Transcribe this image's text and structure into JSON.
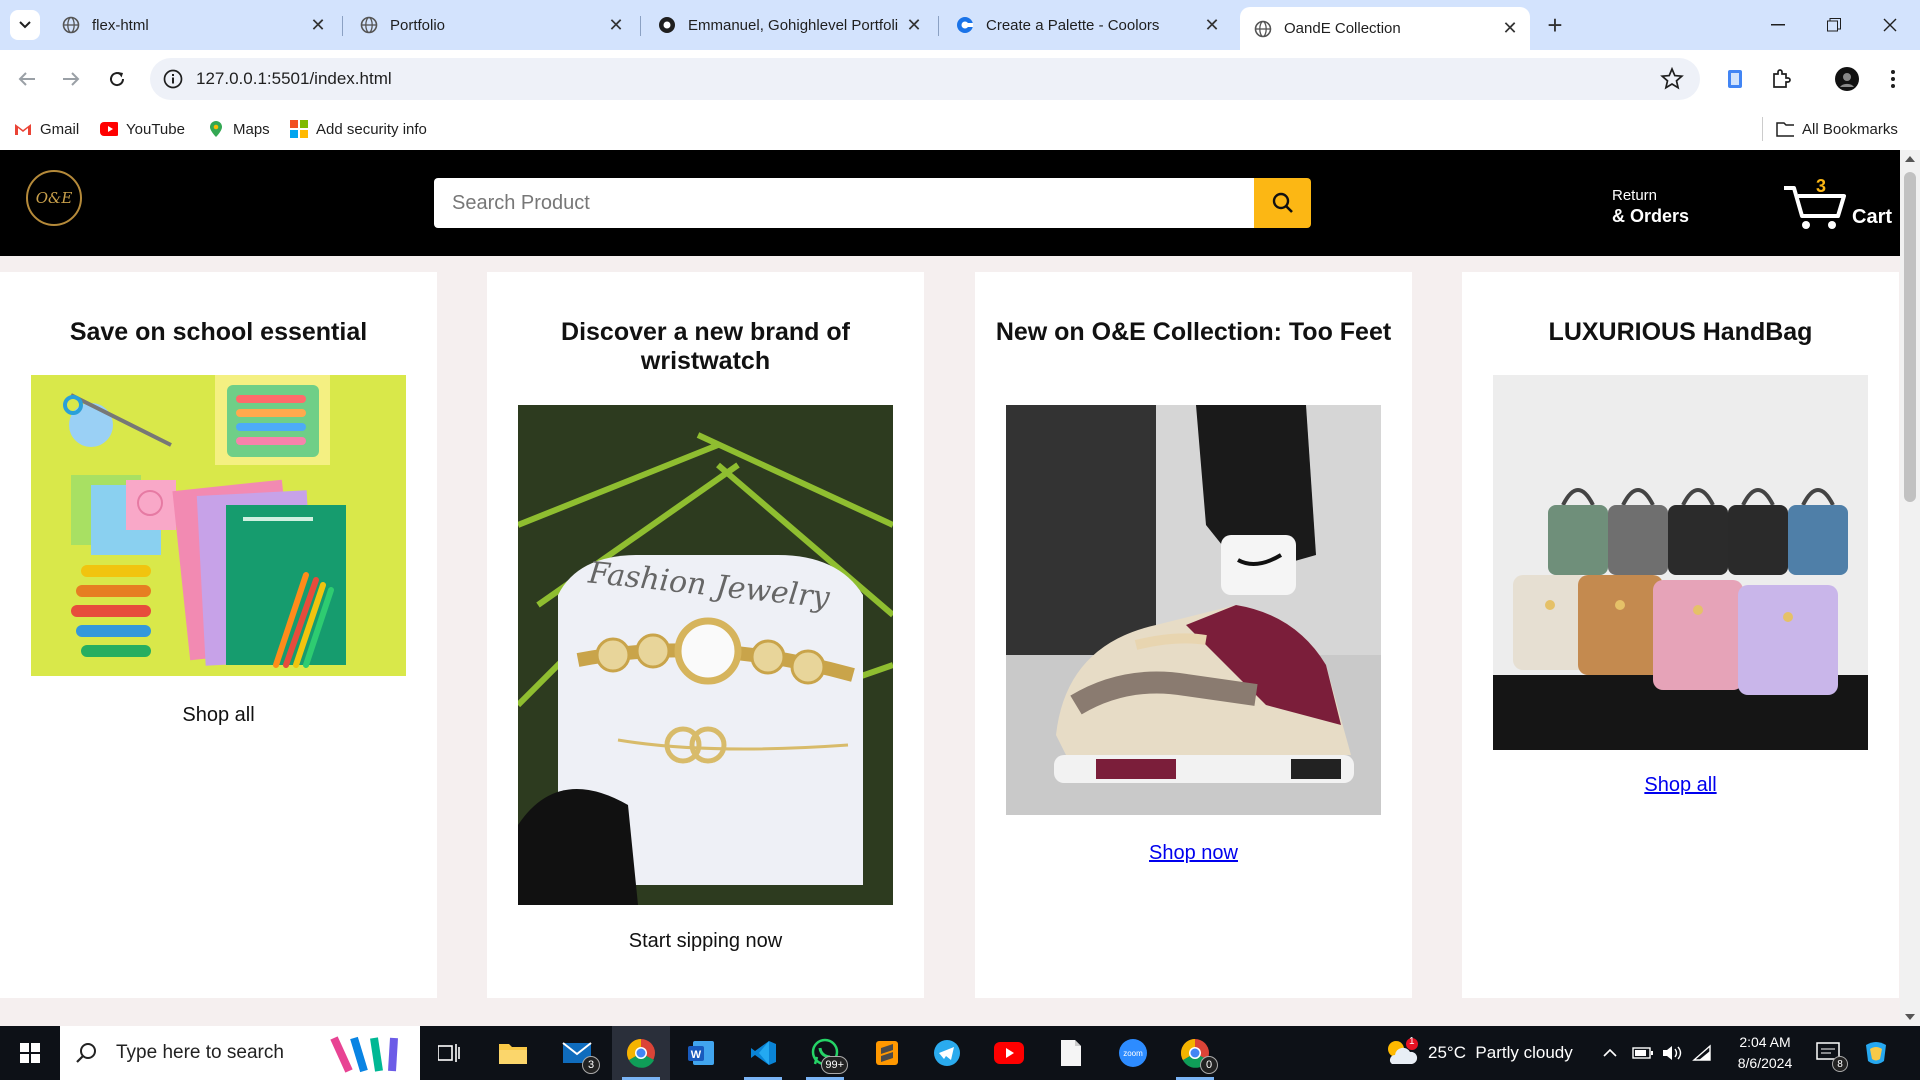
{
  "browser": {
    "tabs": [
      {
        "title": "flex-html",
        "active": false
      },
      {
        "title": "Portfolio",
        "active": false
      },
      {
        "title": "Emmanuel, Gohighlevel Portfoli",
        "active": false
      },
      {
        "title": "Create a Palette - Coolors",
        "active": false
      },
      {
        "title": "OandE Collection",
        "active": true
      }
    ],
    "url": "127.0.0.1:5501/index.html",
    "bookmarks": [
      {
        "label": "Gmail",
        "icon": "gmail-icon"
      },
      {
        "label": "YouTube",
        "icon": "youtube-icon"
      },
      {
        "label": "Maps",
        "icon": "maps-icon"
      },
      {
        "label": "Add security info",
        "icon": "microsoft-icon"
      }
    ],
    "all_bookmarks_label": "All Bookmarks"
  },
  "site": {
    "logo_text": "O&E",
    "search_placeholder": "Search Product",
    "returns_line1": "Return",
    "returns_line2": "& Orders",
    "cart_count": "3",
    "cart_label": "Cart",
    "accent_color": "#fcb714"
  },
  "cards": [
    {
      "title": "Save on school essential",
      "cta": "Shop all",
      "cta_is_link": false,
      "image": "school-supplies-image"
    },
    {
      "title": "Discover a new brand of wristwatch",
      "cta": "Start sipping now",
      "cta_is_link": false,
      "image": "wristwatch-jewelry-image",
      "image_text": "Fashion Jewelry"
    },
    {
      "title": "New on O&E Collection: Too Feet",
      "cta": "Shop now",
      "cta_is_link": true,
      "image": "sneakers-image"
    },
    {
      "title": "LUXURIOUS HandBag",
      "cta": "Shop all",
      "cta_is_link": true,
      "image": "handbags-image"
    }
  ],
  "taskbar": {
    "search_placeholder": "Type here to search",
    "mail_badge": "3",
    "whatsapp_badge": "99+",
    "chrome2_badge": "0",
    "weather": "25°C  Partly cloudy",
    "weather_badge": "1",
    "time": "2:04 AM",
    "date": "8/6/2024",
    "notifications": "8"
  }
}
